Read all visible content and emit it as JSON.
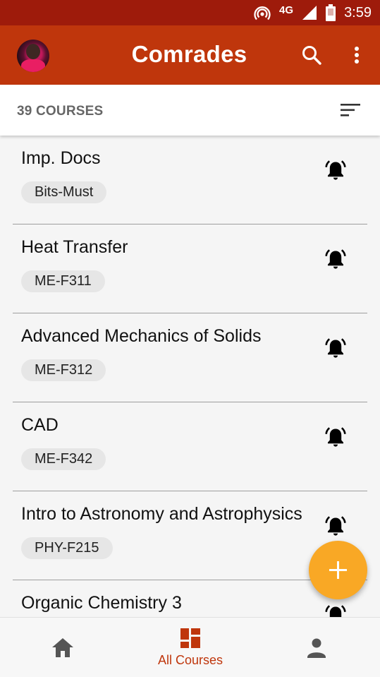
{
  "status_bar": {
    "network": "4G",
    "time": "3:59"
  },
  "app_bar": {
    "title": "Comrades"
  },
  "subheader": {
    "course_count": "39 COURSES"
  },
  "courses": [
    {
      "name": "Imp. Docs",
      "code": "Bits-Must"
    },
    {
      "name": "Heat Transfer",
      "code": "ME-F311"
    },
    {
      "name": "Advanced Mechanics of Solids",
      "code": "ME-F312"
    },
    {
      "name": "CAD",
      "code": "ME-F342"
    },
    {
      "name": "Intro to Astronomy and Astrophysics",
      "code": "PHY-F215"
    },
    {
      "name": "Organic Chemistry 3",
      "code": ""
    }
  ],
  "bottom_nav": {
    "courses_label": "All Courses"
  },
  "colors": {
    "primary": "#bf360c",
    "status_bar": "#9e1b0b",
    "fab": "#f9a825"
  },
  "icons": [
    "hotspot-icon",
    "signal-icon",
    "battery-icon",
    "search-icon",
    "more-vert-icon",
    "sort-icon",
    "bell-ring-icon",
    "add-icon",
    "home-icon",
    "dashboard-icon",
    "person-icon"
  ]
}
